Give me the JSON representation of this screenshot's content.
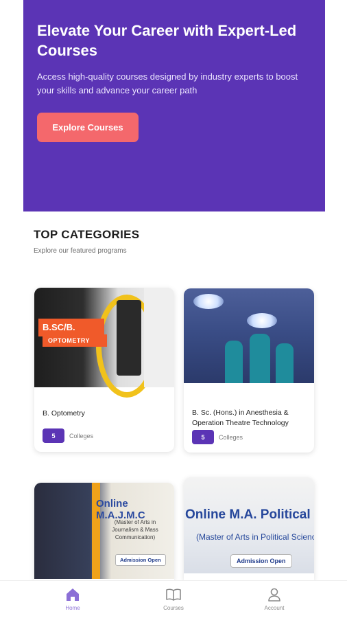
{
  "hero": {
    "title": "Elevate Your Career with Expert-Led Courses",
    "subtitle": "Access high-quality courses designed by industry experts to boost your skills and advance your career path",
    "button_label": "Explore Courses"
  },
  "categories": {
    "title": "TOP CATEGORIES",
    "subtitle": "Explore our featured programs",
    "items": [
      {
        "name": "B. Optometry",
        "count": "5",
        "count_label": "Colleges",
        "image_text": [
          "B.SC/B.",
          "OPTOMETRY"
        ]
      },
      {
        "name": "B. Sc. (Hons.) in Anesthesia & Operation Theatre Technology",
        "count": "5",
        "count_label": "Colleges"
      },
      {
        "image_text": [
          "Online M.A.J.M.C",
          "(Master of Arts in Journalism & Mass Communication)",
          "Admission Open"
        ]
      },
      {
        "image_text": [
          "Online M.A. Political Science",
          "(Master of Arts in Political Science)",
          "Admission Open"
        ]
      }
    ]
  },
  "bottom_nav": {
    "items": [
      {
        "label": "Home",
        "icon": "home-icon",
        "active": true
      },
      {
        "label": "Courses",
        "icon": "book-icon",
        "active": false
      },
      {
        "label": "Account",
        "icon": "user-icon",
        "active": false
      }
    ]
  },
  "colors": {
    "primary": "#5b34b5",
    "cta": "#f4686c",
    "nav_active": "#8b6fd6"
  }
}
